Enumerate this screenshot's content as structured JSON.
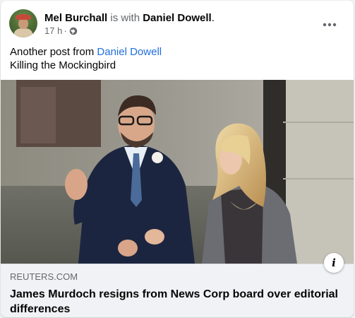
{
  "post": {
    "author": "Mel Burchall",
    "with_text": " is with ",
    "tagged": "Daniel Dowell",
    "tagged_suffix": ".",
    "time": "17 h",
    "dot": "·",
    "privacy_icon": "globe-icon",
    "more_icon": "more-horizontal-icon",
    "text_prefix": "Another post from ",
    "text_mention": "Daniel Dowell",
    "text_line2": "Killing the Mockingbird"
  },
  "link": {
    "domain": "REUTERS.COM",
    "headline": "James Murdoch resigns from News Corp board over editorial differences",
    "info_label": "i"
  },
  "colors": {
    "link_blue": "#216fdb",
    "secondary_text": "#65676b",
    "link_box_bg": "#f0f2f5"
  }
}
